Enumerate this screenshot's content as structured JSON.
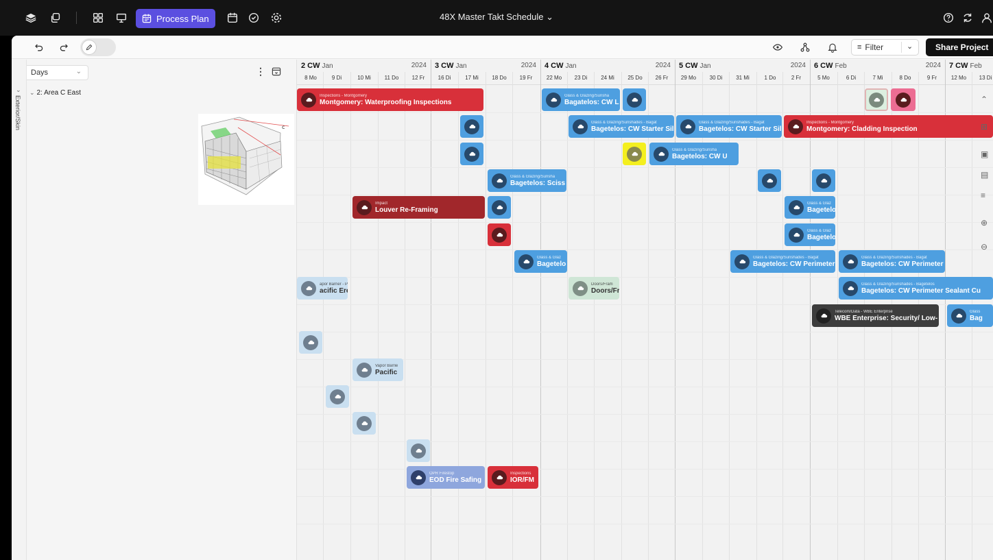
{
  "topbar": {
    "active_tab": "Process Plan",
    "title": "48X Master Takt Schedule"
  },
  "toolbar": {
    "filter_label": "Filter",
    "share_label": "Share Project"
  },
  "left_panel": {
    "view_select": "Days",
    "section_label": "Exterior/Skin",
    "area_label": "2: Area C East"
  },
  "weeks": [
    {
      "week": "2 CW",
      "month": "Jan",
      "year": "2024"
    },
    {
      "week": "3 CW",
      "month": "Jan",
      "year": "2024"
    },
    {
      "week": "4 CW",
      "month": "Jan",
      "year": "2024"
    },
    {
      "week": "5 CW",
      "month": "Jan",
      "year": "2024"
    },
    {
      "week": "6 CW",
      "month": "Feb",
      "year": "2024"
    },
    {
      "week": "7 CW",
      "month": "Feb",
      "year": ""
    }
  ],
  "days": [
    "8 Mo",
    "9 Di",
    "10 Mi",
    "11 Do",
    "12 Fr",
    "16 Di",
    "17 Mi",
    "18 Do",
    "19 Fr",
    "22 Mo",
    "23 Di",
    "24 Mi",
    "25 Do",
    "26 Fr",
    "29 Mo",
    "30 Di",
    "31 Mi",
    "1 Do",
    "2 Fr",
    "5 Mo",
    "6 Di",
    "7 Mi",
    "8 Do",
    "9 Fr",
    "12 Mo",
    "13 Di"
  ],
  "tasks": [
    {
      "cat": "Inspections - Montgomery",
      "name": "Montgomery: Waterproofing Inspections",
      "color": "red"
    },
    {
      "cat": "Glass & Glazing/Sunsha",
      "name": "Bagatelos: CW L",
      "color": "blue"
    },
    {
      "cat": "",
      "name": "",
      "color": "blue"
    },
    {
      "cat": "",
      "name": "",
      "color": "gray"
    },
    {
      "cat": "",
      "name": "",
      "color": "pink"
    },
    {
      "cat": "",
      "name": "",
      "color": "blue"
    },
    {
      "cat": "Glass & Glazing/Sunshades - Bagat",
      "name": "Bagetelos: CW Starter Sil",
      "color": "blue"
    },
    {
      "cat": "Glass & Glazing/Sunshades - Bagat",
      "name": "Bagetelos: CW Starter Sil",
      "color": "blue"
    },
    {
      "cat": "Inspections - Montgomery",
      "name": "Montgomery: Cladding Inspection",
      "color": "red"
    },
    {
      "cat": "",
      "name": "",
      "color": "blue"
    },
    {
      "cat": "",
      "name": "",
      "color": "yellow"
    },
    {
      "cat": "Glass & Glazing/Sunsha",
      "name": "Bagetelos: CW U",
      "color": "blue"
    },
    {
      "cat": "Glass & Glazing/Sunsha",
      "name": "Bagetelos: Sciss",
      "color": "blue"
    },
    {
      "cat": "",
      "name": "",
      "color": "blue"
    },
    {
      "cat": "",
      "name": "",
      "color": "blue"
    },
    {
      "cat": "Impact",
      "name": "Louver Re-Framing",
      "color": "dred"
    },
    {
      "cat": "",
      "name": "",
      "color": "blue"
    },
    {
      "cat": "Glass & Glaz",
      "name": "Bagetelo",
      "color": "blue"
    },
    {
      "cat": "",
      "name": "",
      "color": "red"
    },
    {
      "cat": "Glass & Glaz",
      "name": "Bagetelo",
      "color": "blue"
    },
    {
      "cat": "Glass & Glaz",
      "name": "Bagetelo",
      "color": "blue"
    },
    {
      "cat": "Glass & Glazing/Sunshades - Bagat",
      "name": "Bagetelos: CW Perimeter",
      "color": "blue"
    },
    {
      "cat": "Glass & Glazing/Sunshades - Bagat",
      "name": "Bagetelos: CW Perimeter",
      "color": "blue"
    },
    {
      "cat": "apor Barrier - Pacific E",
      "name": "acific Erectors:",
      "color": "lblue"
    },
    {
      "cat": "Doors/Fram",
      "name": "Doors/Fr",
      "color": "lgreen"
    },
    {
      "cat": "Glass & Glazing/Sunshades - Bagetelos",
      "name": "Bagetelos: CW Perimeter Sealant Cu",
      "color": "blue"
    },
    {
      "cat": "Telecom/Data - WBE Enterprise",
      "name": "WBE Enterprise: Security/ Low-",
      "color": "dark"
    },
    {
      "cat": "Glass",
      "name": "Bag",
      "color": "blue"
    },
    {
      "cat": "",
      "name": "",
      "color": "lblue"
    },
    {
      "cat": "Vapor Barrie",
      "name": "Pacific",
      "color": "lblue"
    },
    {
      "cat": "",
      "name": "",
      "color": "lblue"
    },
    {
      "cat": "",
      "name": "",
      "color": "lblue"
    },
    {
      "cat": "",
      "name": "",
      "color": "lblue"
    },
    {
      "cat": "OPR Firestop",
      "name": "EOD Fire Safing",
      "color": "slate"
    },
    {
      "cat": "Inspections",
      "name": "IOR/FM",
      "color": "red"
    }
  ]
}
